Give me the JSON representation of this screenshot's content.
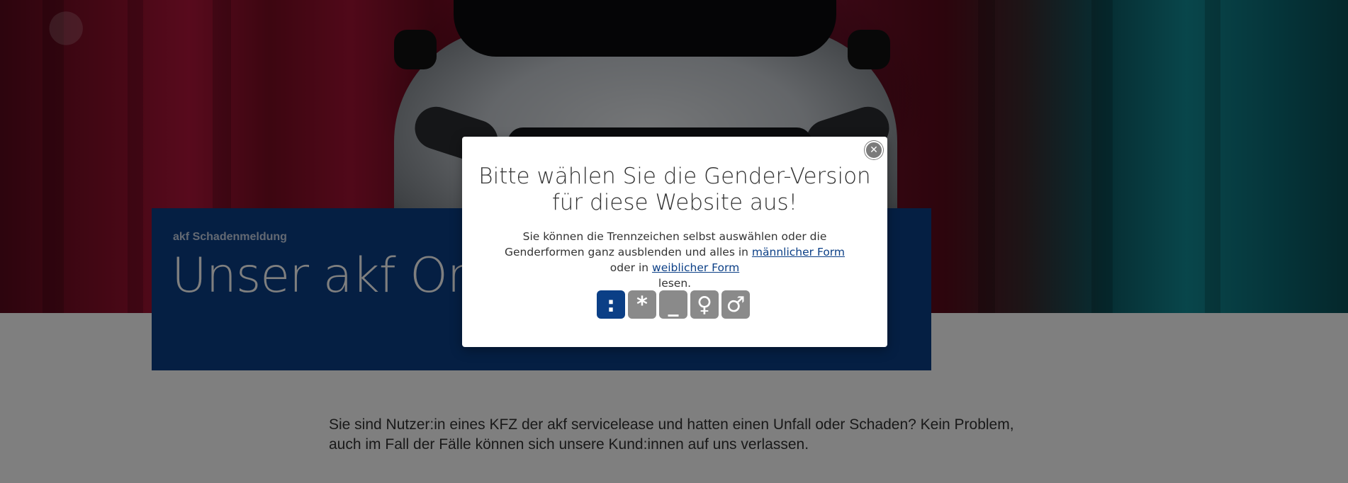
{
  "hero": {
    "image_alt": "",
    "colors": {
      "left": "#b0153a",
      "right": "#118c96",
      "panel": "#0b3f86"
    }
  },
  "intro": {
    "kicker": "akf Schadenmeldung",
    "title": "Unser akf Onl"
  },
  "body_text": "Sie sind Nutzer:in eines KFZ der akf servicelease und hatten einen Unfall oder Schaden? Kein Problem, auch im Fall der Fälle können sich unsere Kund:innen auf uns verlassen.",
  "modal": {
    "close_icon": "close-icon",
    "title_line1": "Bitte wählen Sie die Gender-Version",
    "title_line2": "für diese Website aus!",
    "desc_part1": "Sie können die Trennzeichen selbst auswählen oder die Genderformen ganz ausblenden und alles in",
    "link_male": "männlicher Form",
    "desc_part2": "oder in",
    "link_female": "weiblicher Form",
    "desc_part3": "lesen.",
    "options": [
      {
        "symbol": ":",
        "name": "colon",
        "active": true
      },
      {
        "symbol": "*",
        "name": "asterisk",
        "active": false
      },
      {
        "symbol": "_",
        "name": "underscore",
        "active": false
      },
      {
        "symbol": "♀",
        "name": "female",
        "active": false
      },
      {
        "symbol": "♂",
        "name": "male",
        "active": false
      }
    ],
    "accent_color": "#0b3f86",
    "inactive_color": "#8a8a8a"
  }
}
